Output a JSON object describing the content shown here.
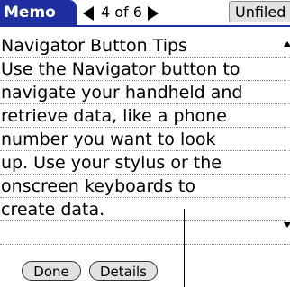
{
  "header": {
    "app_name": "Memo",
    "record_counter": "4 of 6",
    "category": "Unfiled"
  },
  "memo": {
    "lines": [
      "Navigator Button Tips",
      "Use the Navigator button to",
      "navigate your handheld and",
      "retrieve data, like a phone",
      "number you want to look",
      "up. Use your stylus or the",
      "onscreen keyboards to",
      "create data.",
      ""
    ]
  },
  "buttons": {
    "done": "Done",
    "details": "Details"
  },
  "icons": {
    "prev": "left-arrow-icon",
    "next": "right-arrow-icon",
    "scroll_up": "scroll-up-icon",
    "scroll_down": "scroll-down-icon"
  },
  "colors": {
    "title_bar": "#1f2f9f",
    "button_bg": "#e2e2e2"
  }
}
